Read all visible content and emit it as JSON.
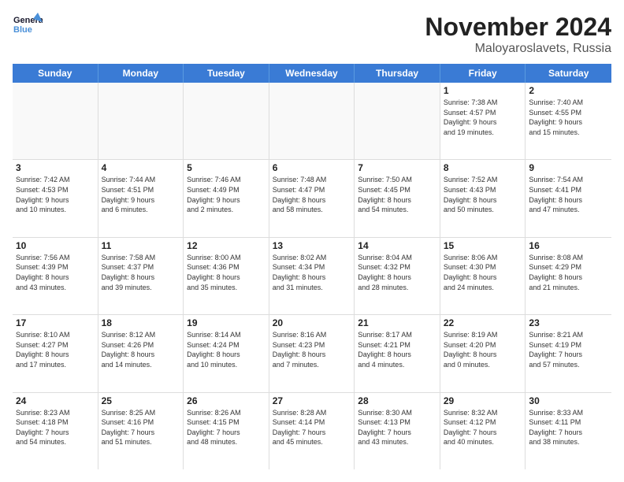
{
  "logo": {
    "line1": "General",
    "line2": "Blue"
  },
  "title": "November 2024",
  "location": "Maloyaroslavets, Russia",
  "header_days": [
    "Sunday",
    "Monday",
    "Tuesday",
    "Wednesday",
    "Thursday",
    "Friday",
    "Saturday"
  ],
  "weeks": [
    [
      {
        "day": "",
        "info": ""
      },
      {
        "day": "",
        "info": ""
      },
      {
        "day": "",
        "info": ""
      },
      {
        "day": "",
        "info": ""
      },
      {
        "day": "",
        "info": ""
      },
      {
        "day": "1",
        "info": "Sunrise: 7:38 AM\nSunset: 4:57 PM\nDaylight: 9 hours\nand 19 minutes."
      },
      {
        "day": "2",
        "info": "Sunrise: 7:40 AM\nSunset: 4:55 PM\nDaylight: 9 hours\nand 15 minutes."
      }
    ],
    [
      {
        "day": "3",
        "info": "Sunrise: 7:42 AM\nSunset: 4:53 PM\nDaylight: 9 hours\nand 10 minutes."
      },
      {
        "day": "4",
        "info": "Sunrise: 7:44 AM\nSunset: 4:51 PM\nDaylight: 9 hours\nand 6 minutes."
      },
      {
        "day": "5",
        "info": "Sunrise: 7:46 AM\nSunset: 4:49 PM\nDaylight: 9 hours\nand 2 minutes."
      },
      {
        "day": "6",
        "info": "Sunrise: 7:48 AM\nSunset: 4:47 PM\nDaylight: 8 hours\nand 58 minutes."
      },
      {
        "day": "7",
        "info": "Sunrise: 7:50 AM\nSunset: 4:45 PM\nDaylight: 8 hours\nand 54 minutes."
      },
      {
        "day": "8",
        "info": "Sunrise: 7:52 AM\nSunset: 4:43 PM\nDaylight: 8 hours\nand 50 minutes."
      },
      {
        "day": "9",
        "info": "Sunrise: 7:54 AM\nSunset: 4:41 PM\nDaylight: 8 hours\nand 47 minutes."
      }
    ],
    [
      {
        "day": "10",
        "info": "Sunrise: 7:56 AM\nSunset: 4:39 PM\nDaylight: 8 hours\nand 43 minutes."
      },
      {
        "day": "11",
        "info": "Sunrise: 7:58 AM\nSunset: 4:37 PM\nDaylight: 8 hours\nand 39 minutes."
      },
      {
        "day": "12",
        "info": "Sunrise: 8:00 AM\nSunset: 4:36 PM\nDaylight: 8 hours\nand 35 minutes."
      },
      {
        "day": "13",
        "info": "Sunrise: 8:02 AM\nSunset: 4:34 PM\nDaylight: 8 hours\nand 31 minutes."
      },
      {
        "day": "14",
        "info": "Sunrise: 8:04 AM\nSunset: 4:32 PM\nDaylight: 8 hours\nand 28 minutes."
      },
      {
        "day": "15",
        "info": "Sunrise: 8:06 AM\nSunset: 4:30 PM\nDaylight: 8 hours\nand 24 minutes."
      },
      {
        "day": "16",
        "info": "Sunrise: 8:08 AM\nSunset: 4:29 PM\nDaylight: 8 hours\nand 21 minutes."
      }
    ],
    [
      {
        "day": "17",
        "info": "Sunrise: 8:10 AM\nSunset: 4:27 PM\nDaylight: 8 hours\nand 17 minutes."
      },
      {
        "day": "18",
        "info": "Sunrise: 8:12 AM\nSunset: 4:26 PM\nDaylight: 8 hours\nand 14 minutes."
      },
      {
        "day": "19",
        "info": "Sunrise: 8:14 AM\nSunset: 4:24 PM\nDaylight: 8 hours\nand 10 minutes."
      },
      {
        "day": "20",
        "info": "Sunrise: 8:16 AM\nSunset: 4:23 PM\nDaylight: 8 hours\nand 7 minutes."
      },
      {
        "day": "21",
        "info": "Sunrise: 8:17 AM\nSunset: 4:21 PM\nDaylight: 8 hours\nand 4 minutes."
      },
      {
        "day": "22",
        "info": "Sunrise: 8:19 AM\nSunset: 4:20 PM\nDaylight: 8 hours\nand 0 minutes."
      },
      {
        "day": "23",
        "info": "Sunrise: 8:21 AM\nSunset: 4:19 PM\nDaylight: 7 hours\nand 57 minutes."
      }
    ],
    [
      {
        "day": "24",
        "info": "Sunrise: 8:23 AM\nSunset: 4:18 PM\nDaylight: 7 hours\nand 54 minutes."
      },
      {
        "day": "25",
        "info": "Sunrise: 8:25 AM\nSunset: 4:16 PM\nDaylight: 7 hours\nand 51 minutes."
      },
      {
        "day": "26",
        "info": "Sunrise: 8:26 AM\nSunset: 4:15 PM\nDaylight: 7 hours\nand 48 minutes."
      },
      {
        "day": "27",
        "info": "Sunrise: 8:28 AM\nSunset: 4:14 PM\nDaylight: 7 hours\nand 45 minutes."
      },
      {
        "day": "28",
        "info": "Sunrise: 8:30 AM\nSunset: 4:13 PM\nDaylight: 7 hours\nand 43 minutes."
      },
      {
        "day": "29",
        "info": "Sunrise: 8:32 AM\nSunset: 4:12 PM\nDaylight: 7 hours\nand 40 minutes."
      },
      {
        "day": "30",
        "info": "Sunrise: 8:33 AM\nSunset: 4:11 PM\nDaylight: 7 hours\nand 38 minutes."
      }
    ]
  ]
}
